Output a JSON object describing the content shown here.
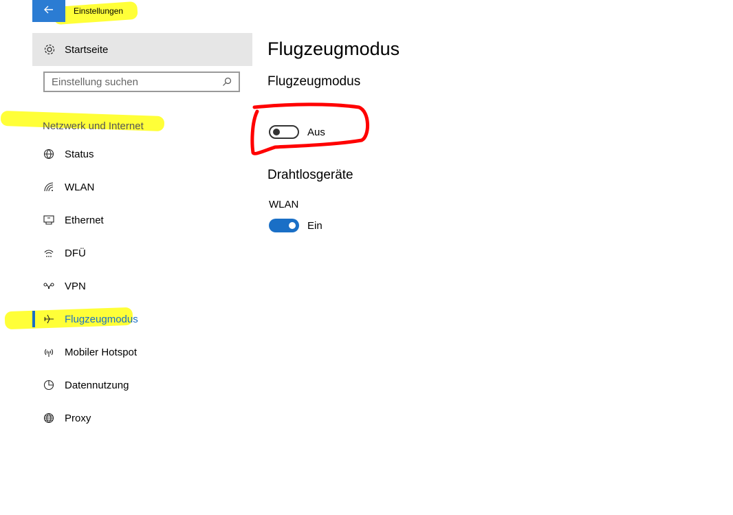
{
  "app": {
    "title": "Einstellungen"
  },
  "home": {
    "label": "Startseite"
  },
  "search": {
    "placeholder": "Einstellung suchen"
  },
  "sidebar": {
    "section": "Netzwerk und Internet",
    "items": [
      {
        "label": "Status",
        "icon": "globe-status-icon"
      },
      {
        "label": "WLAN",
        "icon": "wifi-icon"
      },
      {
        "label": "Ethernet",
        "icon": "ethernet-icon"
      },
      {
        "label": "DFÜ",
        "icon": "dialup-icon"
      },
      {
        "label": "VPN",
        "icon": "vpn-icon"
      },
      {
        "label": "Flugzeugmodus",
        "icon": "airplane-icon",
        "active": true
      },
      {
        "label": "Mobiler Hotspot",
        "icon": "hotspot-icon"
      },
      {
        "label": "Datennutzung",
        "icon": "pie-chart-icon"
      },
      {
        "label": "Proxy",
        "icon": "globe-icon"
      }
    ]
  },
  "main": {
    "title": "Flugzeugmodus",
    "airplane": {
      "heading": "Flugzeugmodus",
      "state": "Aus",
      "on": false
    },
    "wireless": {
      "heading": "Drahtlosgeräte",
      "wlan": {
        "label": "WLAN",
        "state": "Ein",
        "on": true
      }
    }
  },
  "colors": {
    "accent": "#1a6fc6",
    "title_bar": "#2b7cd3",
    "highlight": "#ffff00",
    "annotation": "#ff0000"
  }
}
